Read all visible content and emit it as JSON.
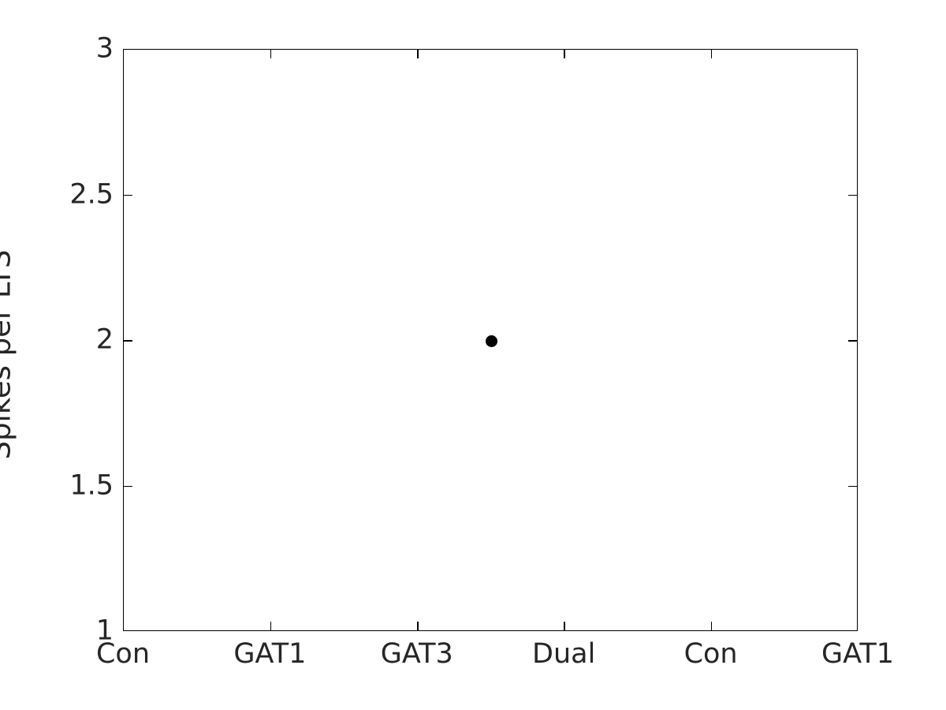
{
  "chart_data": {
    "type": "scatter",
    "title": "",
    "xlabel": "",
    "ylabel": "Spikes per LTS",
    "categories": [
      "Con",
      "GAT1",
      "GAT3",
      "Dual",
      "Con",
      "GAT1"
    ],
    "x_tick_labels": [
      "Con",
      "GAT1",
      "GAT3",
      "Dual",
      "Con",
      "GAT1"
    ],
    "x_tick_positions": [
      0,
      1,
      2,
      3,
      4,
      5
    ],
    "xlim": [
      0,
      5
    ],
    "y_tick_labels": [
      "1",
      "1.5",
      "2",
      "2.5",
      "3"
    ],
    "y_tick_values": [
      1,
      1.5,
      2,
      2.5,
      3
    ],
    "ylim": [
      1,
      3
    ],
    "grid": false,
    "legend": false,
    "marker_color": "#000000",
    "axis_color": "#000000",
    "text_color": "#262626",
    "background_color": "#ffffff",
    "series": [
      {
        "name": "spikes per LTS",
        "marker": "circle",
        "color": "#000000",
        "points": [
          {
            "x": 2.5,
            "y": 2
          }
        ]
      }
    ]
  }
}
